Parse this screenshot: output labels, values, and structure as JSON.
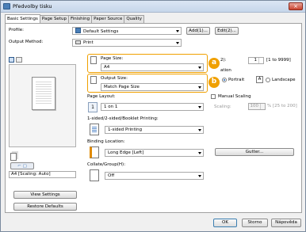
{
  "window": {
    "title": "Předvolby tisku",
    "close_glyph": "×"
  },
  "tabs": [
    "Basic Settings",
    "Page Setup",
    "Finishing",
    "Paper Source",
    "Quality"
  ],
  "profile": {
    "label": "Profile:",
    "value": "Default Settings",
    "add_label": "Add(1)...",
    "edit_label": "Edit(2)..."
  },
  "output_method": {
    "label": "Output Method:",
    "value": "Print"
  },
  "page_size": {
    "label": "Page Size:",
    "value": "A4"
  },
  "output_size": {
    "label": "Output Size:",
    "value": "Match Page Size"
  },
  "copies": {
    "label_fragment": "2):",
    "value": "1",
    "range": "[1 to 9999]"
  },
  "orientation": {
    "label_fragment": "ation",
    "portrait_label": "Portrait",
    "landscape_label": "Landscape",
    "portrait_icon_letter": "A",
    "landscape_icon_letter": "A",
    "selected": "portrait"
  },
  "badges": {
    "a": "a",
    "b": "b"
  },
  "page_layout": {
    "label": "Page Layout:",
    "value": "1 on 1",
    "icon_text": "1"
  },
  "manual_scaling": {
    "label": "Manual Scaling",
    "checked": false
  },
  "scaling": {
    "label": "Scaling:",
    "value": "100",
    "range": "% [25 to 200]"
  },
  "printing": {
    "label": "1-sided/2-sided/Booklet Printing:",
    "value": "1-sided Printing"
  },
  "binding": {
    "label": "Binding Location:",
    "value": "Long Edge [Left]"
  },
  "gutter_label": "Gutter...",
  "collate": {
    "label": "Collate/Group(H):",
    "value": "Off"
  },
  "preview": {
    "status": "A4 [Scaling: Auto]"
  },
  "view_settings_label": "View Settings",
  "restore_defaults_label": "Restore Defaults",
  "footer": {
    "ok_label": "OK",
    "cancel_label": "Storno",
    "help_label": "Nápověda"
  }
}
